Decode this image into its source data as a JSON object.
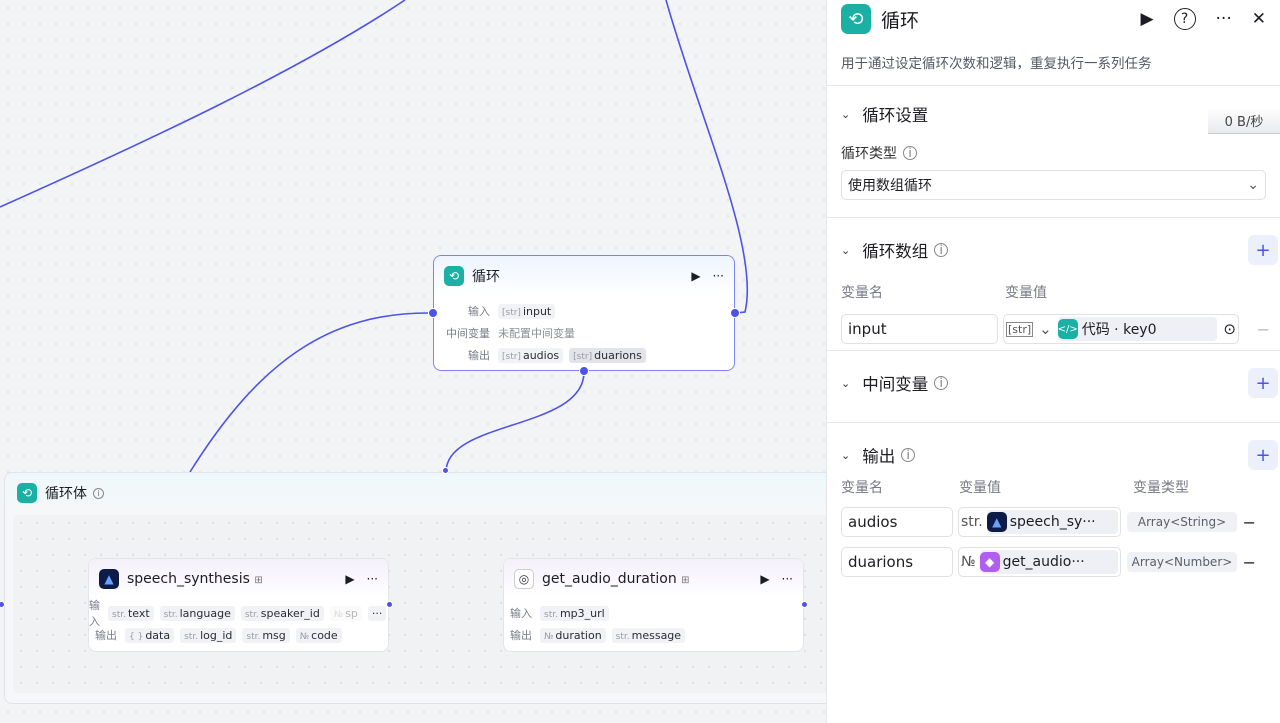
{
  "canvas": {
    "loop_node": {
      "title": "循环",
      "input_label": "输入",
      "input_var": "input",
      "middle_label": "中间变量",
      "middle_value": "未配置中间变量",
      "output_label": "输出",
      "outputs": [
        "audios",
        "duarions"
      ],
      "type_tag": "[str]"
    },
    "loop_body": {
      "title": "循环体"
    },
    "speech_node": {
      "title": "speech_synthesis",
      "input_label": "输入",
      "inputs": [
        {
          "type": "str.",
          "name": "text"
        },
        {
          "type": "str.",
          "name": "language"
        },
        {
          "type": "str.",
          "name": "speaker_id"
        },
        {
          "type": "№",
          "name": "sp"
        }
      ],
      "output_label": "输出",
      "outputs": [
        {
          "type": "{ }",
          "name": "data"
        },
        {
          "type": "str.",
          "name": "log_id"
        },
        {
          "type": "str.",
          "name": "msg"
        },
        {
          "type": "№",
          "name": "code"
        }
      ]
    },
    "duration_node": {
      "title": "get_audio_duration",
      "input_label": "输入",
      "inputs": [
        {
          "type": "str.",
          "name": "mp3_url"
        }
      ],
      "output_label": "输出",
      "outputs": [
        {
          "type": "№",
          "name": "duration"
        },
        {
          "type": "str.",
          "name": "message"
        }
      ]
    }
  },
  "panel": {
    "title": "循环",
    "description": "用于通过设定循环次数和逻辑，重复执行一系列任务",
    "speed_badge": "0 B/秒",
    "loop_settings": {
      "title": "循环设置",
      "type_label": "循环类型",
      "type_value": "使用数组循环"
    },
    "loop_array": {
      "title": "循环数组",
      "col_name": "变量名",
      "col_value": "变量值",
      "name": "input",
      "type_tag": "[str]",
      "value": "代码 · key0"
    },
    "middle_vars": {
      "title": "中间变量"
    },
    "output": {
      "title": "输出",
      "col_name": "变量名",
      "col_value": "变量值",
      "col_type": "变量类型",
      "rows": [
        {
          "name": "audios",
          "type_tag": "str.",
          "value": "speech_sy···",
          "var_type": "Array<String>"
        },
        {
          "name": "duarions",
          "type_tag": "№",
          "value": "get_audio···",
          "var_type": "Array<Number>"
        }
      ]
    }
  },
  "colors": {
    "accent": "#4d53e8",
    "teal": "#1ab0a4"
  }
}
